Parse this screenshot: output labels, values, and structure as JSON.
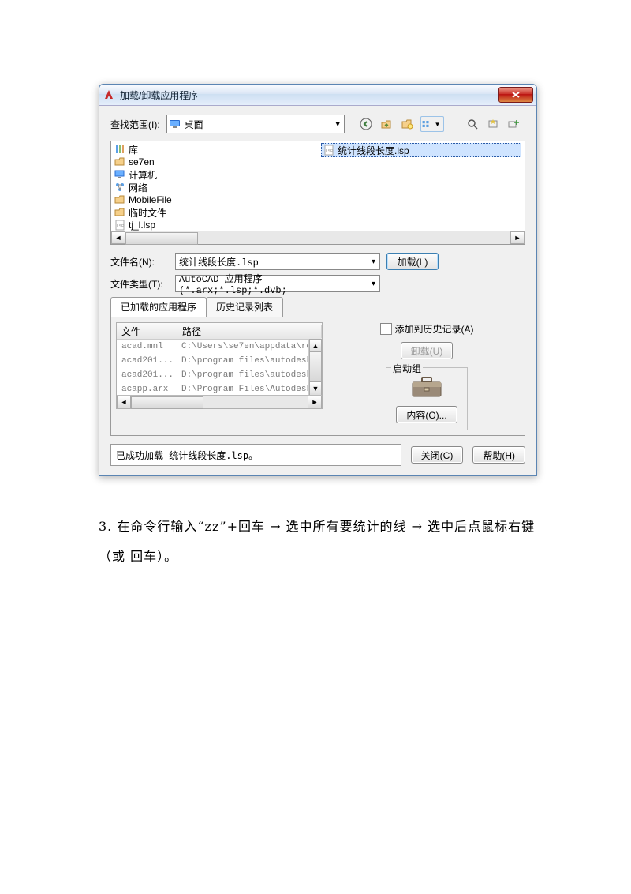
{
  "titlebar": {
    "title": "加载/卸载应用程序"
  },
  "look_in": {
    "label": "查找范围(I):",
    "value": "桌面"
  },
  "file_list_left": [
    {
      "name": "库",
      "icon": "library"
    },
    {
      "name": "se7en",
      "icon": "folder-yellow"
    },
    {
      "name": "计算机",
      "icon": "computer"
    },
    {
      "name": "网络",
      "icon": "network"
    },
    {
      "name": "MobileFile",
      "icon": "folder"
    },
    {
      "name": "临时文件",
      "icon": "folder"
    },
    {
      "name": "tj_l.lsp",
      "icon": "lsp"
    }
  ],
  "file_list_right": [
    {
      "name": "统计线段长度.lsp",
      "icon": "lsp",
      "selected": true
    }
  ],
  "filename": {
    "label": "文件名(N):",
    "value": "统计线段长度.lsp"
  },
  "filetype": {
    "label": "文件类型(T):",
    "value": "AutoCAD 应用程序 (*.arx;*.lsp;*.dvb;"
  },
  "buttons": {
    "load": "加载(L)",
    "unload": "卸载(U)",
    "contents": "内容(O)...",
    "close": "关闭(C)",
    "help": "帮助(H)"
  },
  "tabs": {
    "loaded": "已加载的应用程序",
    "history": "历史记录列表"
  },
  "add_history": "添加到历史记录(A)",
  "startup_legend": "启动组",
  "list_header": {
    "file": "文件",
    "path": "路径"
  },
  "loaded_list": [
    {
      "file": "acad.mnl",
      "path": "C:\\Users\\se7en\\appdata\\ro..."
    },
    {
      "file": "acad201...",
      "path": "D:\\program files\\autodesk..."
    },
    {
      "file": "acad201...",
      "path": "D:\\program files\\autodesk..."
    },
    {
      "file": "acapp.arx",
      "path": "D:\\Program Files\\Autodesk..."
    }
  ],
  "status": "已成功加载 统计线段长度.lsp。",
  "instruction_text": "3. 在命令行输入“zz”+回车 → 选中所有要统计的线 → 选中后点鼠标右键（或 回车）。"
}
